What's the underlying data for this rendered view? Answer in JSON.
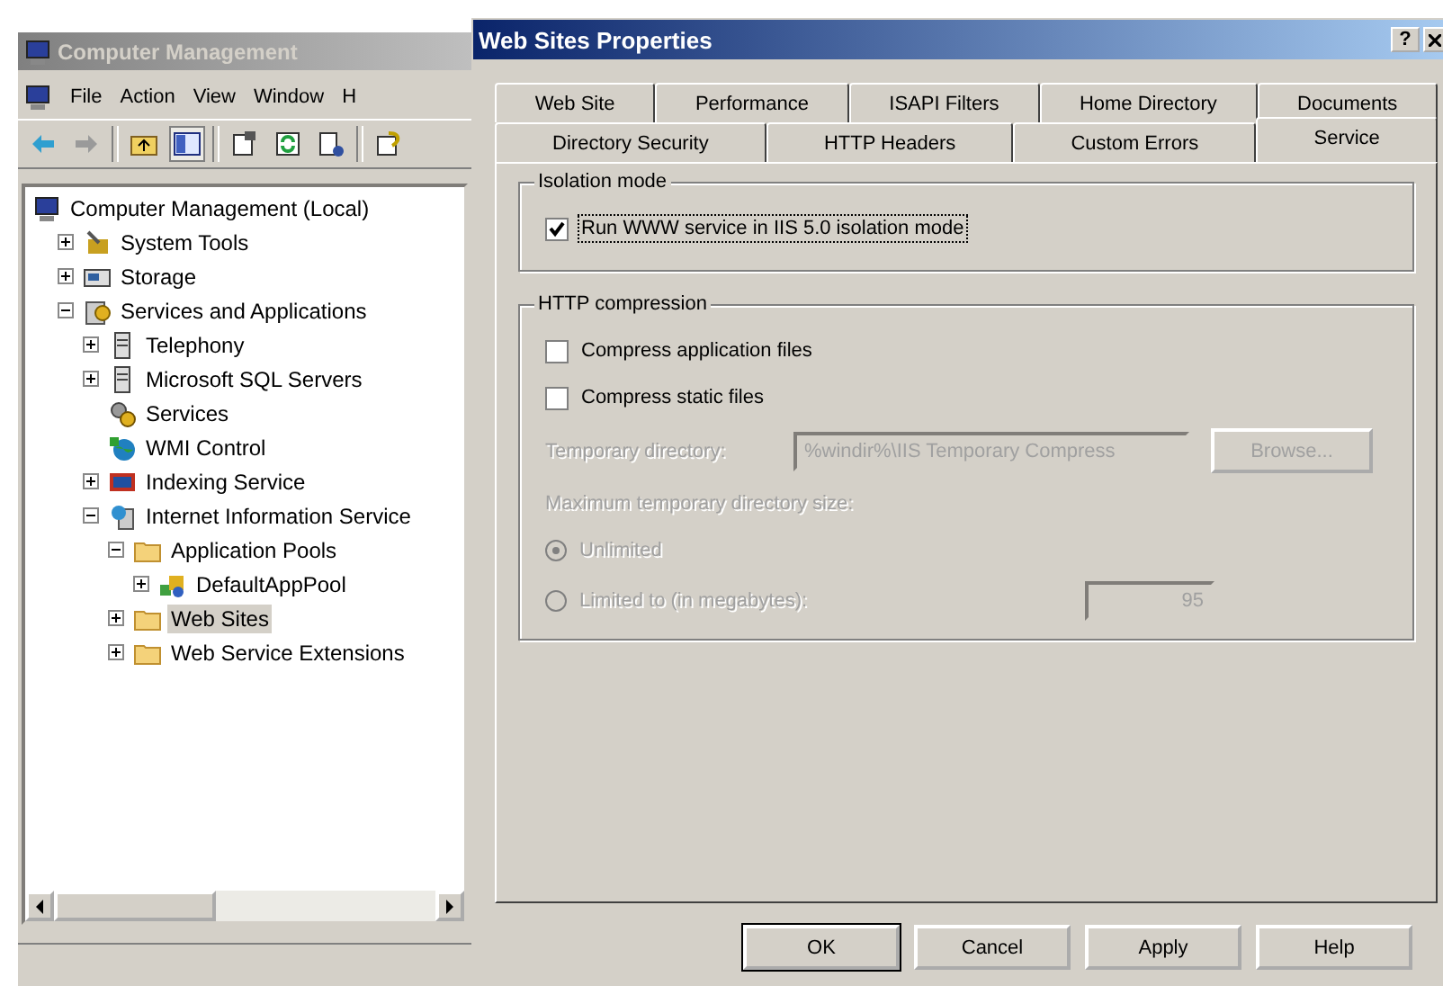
{
  "console": {
    "title": "Computer Management",
    "menu": [
      "File",
      "Action",
      "View",
      "Window",
      "H"
    ],
    "tree": [
      {
        "label": "Computer Management (Local)",
        "kind": "computer",
        "selected": false,
        "children": [
          {
            "label": "System Tools",
            "kind": "tools",
            "expanded": false,
            "selected": false
          },
          {
            "label": "Storage",
            "kind": "storage",
            "expanded": false,
            "selected": false
          },
          {
            "label": "Services and Applications",
            "kind": "apps",
            "expanded": true,
            "selected": false,
            "children": [
              {
                "label": "Telephony",
                "kind": "server",
                "expanded": false,
                "selected": false
              },
              {
                "label": "Microsoft SQL Servers",
                "kind": "server",
                "expanded": false,
                "selected": false
              },
              {
                "label": "Services",
                "kind": "gears",
                "selected": false
              },
              {
                "label": "WMI Control",
                "kind": "globe",
                "selected": false
              },
              {
                "label": "Indexing Service",
                "kind": "search",
                "expanded": false,
                "selected": false
              },
              {
                "label": "Internet Information Service",
                "kind": "iis",
                "expanded": true,
                "selected": false,
                "children": [
                  {
                    "label": "Application Pools",
                    "kind": "folder",
                    "expanded": true,
                    "selected": false,
                    "children": [
                      {
                        "label": "DefaultAppPool",
                        "kind": "pool",
                        "expanded": false,
                        "selected": false
                      }
                    ]
                  },
                  {
                    "label": "Web Sites",
                    "kind": "folder",
                    "expanded": false,
                    "selected": true
                  },
                  {
                    "label": "Web Service Extensions",
                    "kind": "folder",
                    "expanded": false,
                    "selected": false
                  }
                ]
              }
            ]
          }
        ]
      }
    ]
  },
  "dialog": {
    "title": "Web Sites Properties",
    "help_button": "?",
    "tab_rows": [
      [
        {
          "label": "Web Site",
          "selected": false
        },
        {
          "label": "Performance",
          "selected": false
        },
        {
          "label": "ISAPI Filters",
          "selected": false
        },
        {
          "label": "Home Directory",
          "selected": false
        },
        {
          "label": "Documents",
          "selected": false
        }
      ],
      [
        {
          "label": "Directory Security",
          "selected": false
        },
        {
          "label": "HTTP Headers",
          "selected": false
        },
        {
          "label": "Custom Errors",
          "selected": false
        },
        {
          "label": "Service",
          "selected": true
        }
      ]
    ],
    "groups": [
      {
        "title": "Isolation mode",
        "controls": [
          {
            "kind": "checkbox",
            "label": "Run WWW service in IIS 5.0 isolation mode",
            "checked": true,
            "disabled": false,
            "focused": true
          }
        ]
      },
      {
        "title": "HTTP compression",
        "controls": [
          {
            "kind": "checkbox",
            "label": "Compress application files",
            "checked": false,
            "disabled": false,
            "focused": false
          },
          {
            "kind": "checkbox",
            "label": "Compress static files",
            "checked": false,
            "disabled": false,
            "focused": false
          },
          {
            "kind": "field",
            "label": "Temporary directory:",
            "value": "%windir%\\IIS Temporary Compress",
            "button": "Browse...",
            "disabled": true
          },
          {
            "kind": "caption",
            "label": "Maximum temporary directory size:",
            "disabled": true
          },
          {
            "kind": "radio",
            "label": "Unlimited",
            "selected": true,
            "disabled": true
          },
          {
            "kind": "radio",
            "label": "Limited to (in megabytes):",
            "selected": false,
            "disabled": true,
            "value": "95"
          }
        ]
      }
    ],
    "buttons": [
      "OK",
      "Cancel",
      "Apply",
      "Help"
    ]
  }
}
